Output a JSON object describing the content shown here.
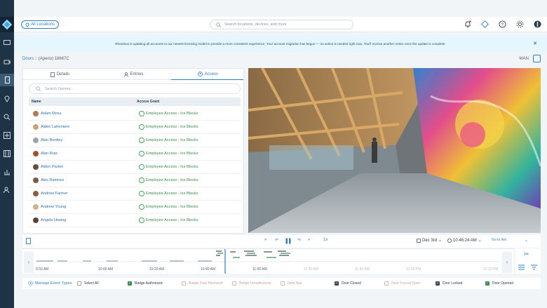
{
  "topbar": {
    "location_button": "All Locations",
    "search_placeholder": "Search locations, devices, and more"
  },
  "banner": {
    "text": "Rhombus is updating all accounts to our newest licensing model to provide a more consistent experience. Your account migration has begun — no action is needed right now. You'll receive another notice once the update is complete."
  },
  "breadcrumb": {
    "root": "Doors",
    "separator": "::",
    "current": "(Aperio) 18667C"
  },
  "network_label": "WAN",
  "tabs": [
    {
      "label": "Details",
      "icon": "document-icon"
    },
    {
      "label": "Entries",
      "icon": "person-icon"
    },
    {
      "label": "Access",
      "icon": "user-circle-icon"
    }
  ],
  "names_search_placeholder": "Search Names...",
  "table": {
    "columns": [
      "Name",
      "Access Grant"
    ],
    "rows": [
      {
        "name": "Adam Moss",
        "grant": "Employee Access - Ice Blocks",
        "avatar_color": "#b07a55"
      },
      {
        "name": "Aiden Lafreniere",
        "grant": "Employee Access - Ice Blocks",
        "avatar_color": "#c8a27a"
      },
      {
        "name": "Alan Bentley",
        "grant": "Employee Access - Ice Blocks",
        "avatar_color": "#9aa5b1"
      },
      {
        "name": "Alan Ruiz",
        "grant": "Employee Access - Ice Blocks",
        "avatar_color": "#a0522d"
      },
      {
        "name": "Alden Parker",
        "grant": "Employee Access - Ice Blocks",
        "avatar_color": "#6b4a3a"
      },
      {
        "name": "Alex Ramirez",
        "grant": "Employee Access - Ice Blocks",
        "avatar_color": "#7d5a44"
      },
      {
        "name": "Andrew Farmer",
        "grant": "Employee Access - Ice Blocks",
        "avatar_color": "#8c5d3f"
      },
      {
        "name": "Andrew Young",
        "grant": "Employee Access - Ice Blocks",
        "avatar_color": "#d6b089"
      },
      {
        "name": "Angela Hwang",
        "grant": "Employee Access - Ice Blocks",
        "avatar_color": "#5d4037"
      }
    ]
  },
  "playback": {
    "speed": "1x",
    "date": "Dec 3rd",
    "time": "10:46:24 AM",
    "live_link": "Go to live"
  },
  "timeline": {
    "labels": [
      "9:33 AM",
      "10:00 AM",
      "10:20 AM",
      "10:40 AM",
      "11:00 AM",
      "11:20 AM",
      "11:40 AM",
      "12:00 PM",
      "12:20 PM"
    ],
    "faded_from_index": 5
  },
  "legend": {
    "manage_label": "Manage Event Types",
    "items": [
      {
        "label": "Select All",
        "checked": false,
        "faded": false
      },
      {
        "label": "Badge Authorized",
        "checked": true,
        "faded": false,
        "color": "#3a8a4e"
      },
      {
        "label": "Badge Fails Mismatch",
        "checked": false,
        "faded": true
      },
      {
        "label": "Badge Unauthorized",
        "checked": false,
        "faded": true
      },
      {
        "label": "Door Ajar",
        "checked": false,
        "faded": true
      },
      {
        "label": "Door Closed",
        "checked": true,
        "faded": false,
        "color": "#3c4a57"
      },
      {
        "label": "Door Forced Open",
        "checked": false,
        "faded": true
      },
      {
        "label": "Door Locked",
        "checked": true,
        "faded": false,
        "color": "#3c4a57"
      },
      {
        "label": "Door Opened",
        "checked": true,
        "faded": false,
        "color": "#3a8a4e"
      }
    ]
  },
  "colors": {
    "sidebar": "#1e3346",
    "accent": "#2d7fc1",
    "success": "#3a8a4e",
    "banner": "#e6f6fd"
  }
}
